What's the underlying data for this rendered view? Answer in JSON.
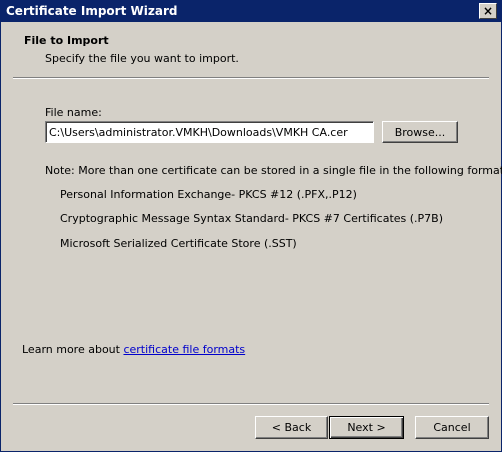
{
  "window": {
    "title": "Certificate Import Wizard",
    "close_glyph": "×"
  },
  "header": {
    "title": "File to Import",
    "subtitle": "Specify the file you want to import."
  },
  "file": {
    "label": "File name:",
    "value": "C:\\Users\\administrator.VMKH\\Downloads\\VMKH CA.cer",
    "browse_label": "Browse..."
  },
  "note": {
    "intro": "Note:  More than one certificate can be stored in a single file in the following formats:",
    "formats": [
      "Personal Information Exchange- PKCS #12 (.PFX,.P12)",
      "Cryptographic Message Syntax Standard- PKCS #7 Certificates (.P7B)",
      "Microsoft Serialized Certificate Store (.SST)"
    ]
  },
  "learn_more": {
    "prefix": "Learn more about ",
    "link_text": "certificate file formats"
  },
  "buttons": {
    "back": "< Back",
    "next": "Next >",
    "cancel": "Cancel"
  },
  "colors": {
    "titlebar": "#0a246a",
    "face": "#d4d0c8",
    "link": "#0000cc"
  }
}
